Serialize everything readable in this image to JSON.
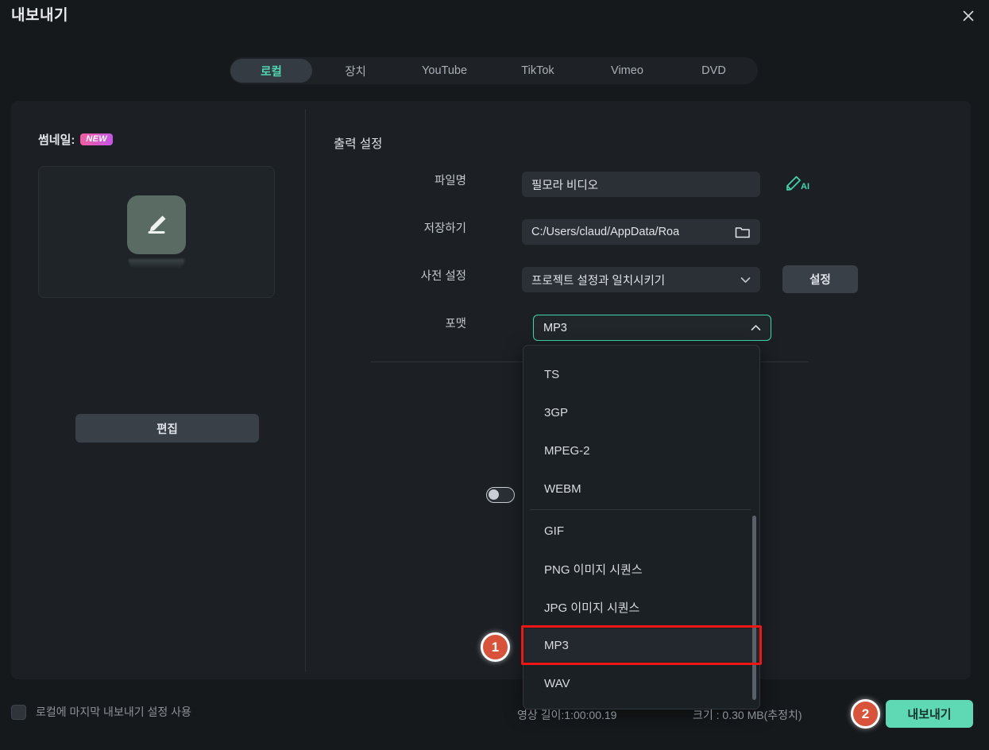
{
  "dialog": {
    "title": "내보내기",
    "close_icon": "close-icon"
  },
  "tabs": [
    {
      "label": "로컬",
      "active": true
    },
    {
      "label": "장치",
      "active": false
    },
    {
      "label": "YouTube",
      "active": false
    },
    {
      "label": "TikTok",
      "active": false
    },
    {
      "label": "Vimeo",
      "active": false
    },
    {
      "label": "DVD",
      "active": false
    }
  ],
  "left_panel": {
    "thumbnail_label": "썸네일:",
    "new_badge": "NEW",
    "thumbnail_icon": "pencil-edit-icon",
    "edit_button": "편집"
  },
  "output_settings": {
    "section_title": "출력 설정",
    "filename": {
      "label": "파일명",
      "value": "필모라 비디오",
      "ai_icon": "ai-pen-icon"
    },
    "save_to": {
      "label": "저장하기",
      "value": "C:/Users/claud/AppData/Roa",
      "folder_icon": "folder-icon"
    },
    "preset": {
      "label": "사전 설정",
      "value": "프로젝트 설정과 일치시키기",
      "chevron_icon": "chevron-down-icon",
      "settings_button": "설정"
    },
    "format": {
      "label": "포맷",
      "value": "MP3",
      "chevron_icon": "chevron-up-icon",
      "open": true,
      "accent_color": "#3fd6ae"
    }
  },
  "format_dropdown": {
    "groups": [
      {
        "items": [
          "TS",
          "3GP",
          "MPEG-2",
          "WEBM"
        ]
      },
      {
        "items": [
          "GIF",
          "PNG 이미지 시퀀스",
          "JPG 이미지 시퀀스",
          "MP3",
          "WAV"
        ]
      }
    ],
    "selected": "MP3",
    "highlight_color": "#f01616"
  },
  "annotations": [
    {
      "number": "1",
      "color": "#d9533a"
    },
    {
      "number": "2",
      "color": "#d9533a"
    }
  ],
  "bottom_bar": {
    "remember_checkbox_label": "로컬에 마지막 내보내기 설정 사용",
    "remember_checked": false,
    "duration_text": "영상 길이:1:00:00.19",
    "size_text": "크기 : 0.30 MB(추정치)",
    "export_button": "내보내기"
  }
}
